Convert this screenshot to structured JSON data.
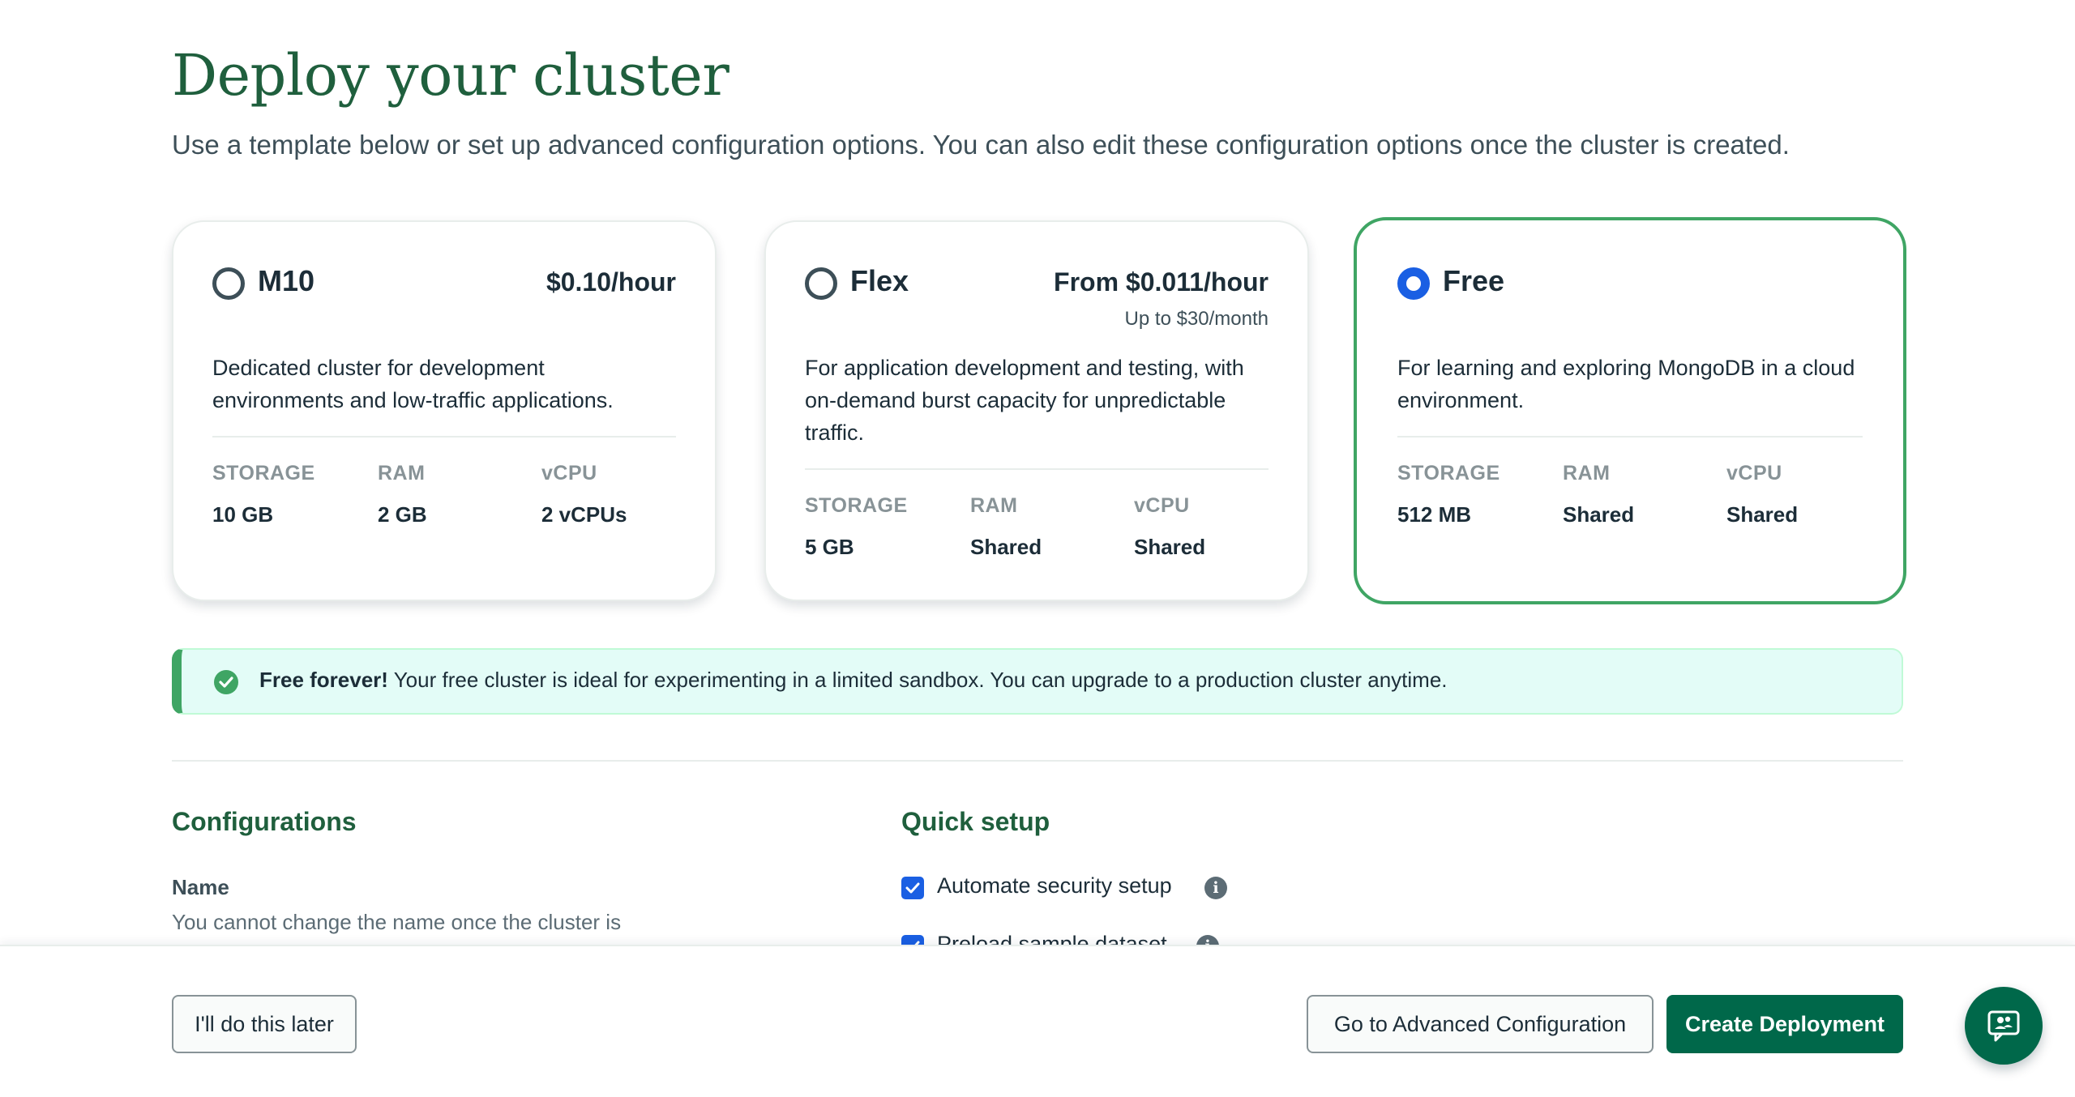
{
  "header": {
    "title": "Deploy your cluster",
    "subtitle": "Use a template below or set up advanced configuration options. You can also edit these configuration options once the cluster is created."
  },
  "plans": [
    {
      "name": "M10",
      "price": "$0.10/hour",
      "price_sub": "",
      "selected": false,
      "description": "Dedicated cluster for development environments and low-traffic applications.",
      "specs": [
        {
          "label": "STORAGE",
          "value": "10 GB"
        },
        {
          "label": "RAM",
          "value": "2 GB"
        },
        {
          "label": "vCPU",
          "value": "2 vCPUs"
        }
      ]
    },
    {
      "name": "Flex",
      "price": "From $0.011/hour",
      "price_sub": "Up to $30/month",
      "selected": false,
      "description": "For application development and testing, with on-demand burst capacity for unpredictable traffic.",
      "specs": [
        {
          "label": "STORAGE",
          "value": "5 GB"
        },
        {
          "label": "RAM",
          "value": "Shared"
        },
        {
          "label": "vCPU",
          "value": "Shared"
        }
      ]
    },
    {
      "name": "Free",
      "price": "",
      "price_sub": "",
      "selected": true,
      "description": "For learning and exploring MongoDB in a cloud environment.",
      "specs": [
        {
          "label": "STORAGE",
          "value": "512 MB"
        },
        {
          "label": "RAM",
          "value": "Shared"
        },
        {
          "label": "vCPU",
          "value": "Shared"
        }
      ]
    }
  ],
  "banner": {
    "icon": "check-circle-icon",
    "bold": "Free forever!",
    "text": " Your free cluster is ideal for experimenting in a limited sandbox. You can upgrade to a production cluster anytime."
  },
  "configurations": {
    "heading": "Configurations",
    "name_label": "Name",
    "name_description": "You cannot change the name once the cluster is created."
  },
  "quick_setup": {
    "heading": "Quick setup",
    "options": [
      {
        "label": "Automate security setup",
        "checked": true
      },
      {
        "label": "Preload sample dataset",
        "checked": true
      }
    ]
  },
  "footer": {
    "later_label": "I'll do this later",
    "advanced_label": "Go to Advanced Configuration",
    "create_label": "Create Deployment"
  },
  "chat": {
    "icon": "chat-support-icon"
  },
  "colors": {
    "brand_green": "#00684a",
    "heading_green": "#1f5f3d",
    "selected_border": "#3fa564",
    "radio_blue": "#1a5fe3",
    "banner_bg": "#e3fcf7"
  }
}
